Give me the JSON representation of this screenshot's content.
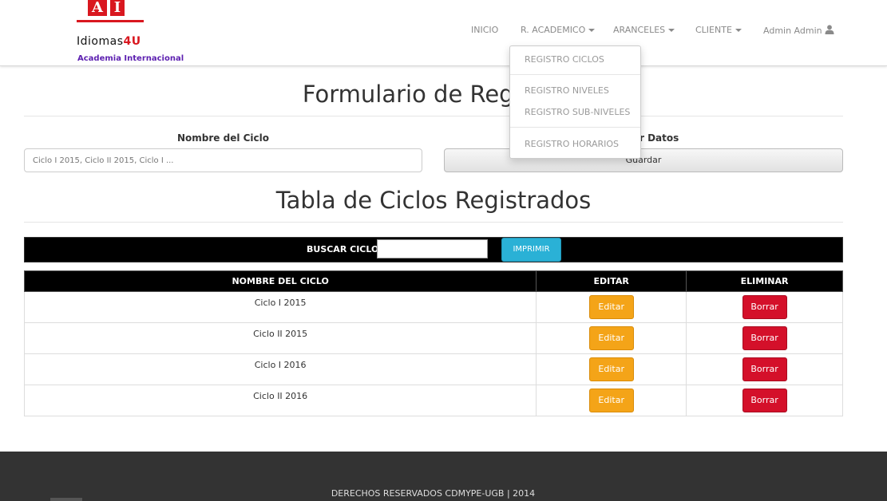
{
  "brand": {
    "logo_letters": [
      "A",
      "I"
    ],
    "logo_word": "Idiomas",
    "logo_number": "4U",
    "subtitle": "Academia Internacional"
  },
  "nav": {
    "items": [
      {
        "label": "INICIO",
        "has_caret": false
      },
      {
        "label": "R. ACADEMICO",
        "has_caret": true
      },
      {
        "label": "ARANCELES",
        "has_caret": true
      },
      {
        "label": "CLIENTE",
        "has_caret": true
      }
    ],
    "user_label": "Admin Admin",
    "user_icon": "user-icon"
  },
  "dropdown": {
    "items": [
      "REGISTRO CICLOS",
      "REGISTRO NIVELES",
      "REGISTRO SUB-NIVELES",
      "REGISTRO HORARIOS"
    ]
  },
  "form": {
    "title": "Formulario de Registro",
    "name_label": "Nombre del Ciclo",
    "name_placeholder": "Ciclo I 2015, Ciclo II 2015, Ciclo I ...",
    "save_label": "r Datos",
    "save_button": "Guardar"
  },
  "table_section": {
    "title": "Tabla de Ciclos Registrados",
    "search_label": "BUSCAR CICLO:",
    "print_button": "IMPRIMIR",
    "columns": [
      "NOMBRE DEL CICLO",
      "EDITAR",
      "ELIMINAR"
    ],
    "edit_label": "Editar",
    "delete_label": "Borrar",
    "rows": [
      {
        "name": "Ciclo I 2015"
      },
      {
        "name": "Ciclo II 2015"
      },
      {
        "name": "Ciclo I 2016"
      },
      {
        "name": "Ciclo II 2016"
      }
    ]
  },
  "footer": {
    "text": "DERECHOS RESERVADOS CDMYPE-UGB | 2014"
  },
  "colors": {
    "brand_red": "#d9171f",
    "subtitle_purple": "#5c1fb0",
    "edit_orange": "#f4a418",
    "delete_red": "#d4102a",
    "print_blue": "#2ab1d6"
  }
}
